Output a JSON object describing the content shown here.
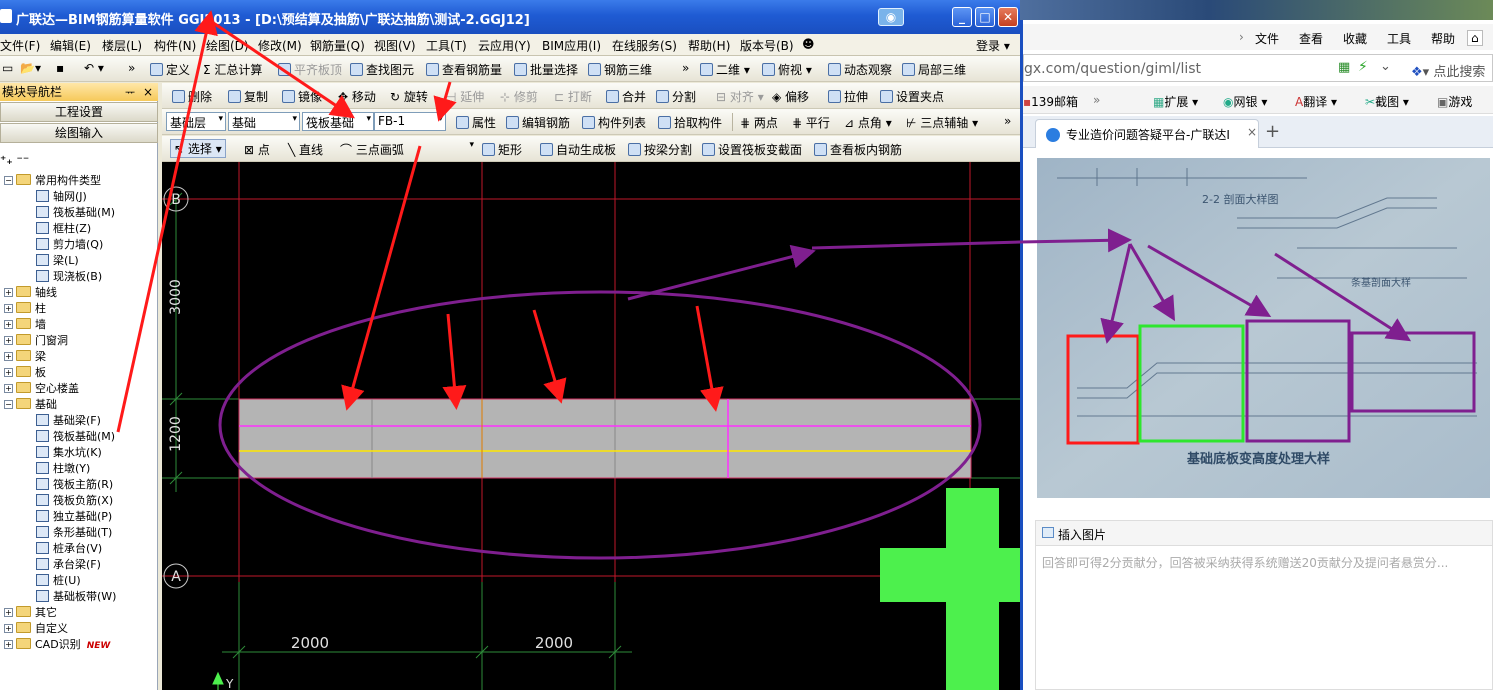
{
  "app": {
    "title": "广联达—BIM钢筋算量软件 GGJ2013 - [D:\\预结算及抽筋\\广联达抽筋\\测试-2.GGJ12]",
    "menus": [
      "文件(F)",
      "编辑(E)",
      "楼层(L)",
      "构件(N)",
      "绘图(D)",
      "修改(M)",
      "钢筋量(Q)",
      "视图(V)",
      "工具(T)",
      "云应用(Y)",
      "BIM应用(I)",
      "在线服务(S)",
      "帮助(H)",
      "版本号(B)"
    ],
    "login": "登录",
    "toolbar1": [
      "定义",
      "汇总计算",
      "平齐板顶",
      "查找图元",
      "查看钢筋量",
      "批量选择",
      "钢筋三维",
      "二维",
      "俯视",
      "动态观察",
      "局部三维"
    ],
    "toolbar2": [
      "删除",
      "复制",
      "镜像",
      "移动",
      "旋转",
      "延伸",
      "修剪",
      "打断",
      "合并",
      "分割",
      "对齐",
      "偏移",
      "拉伸",
      "设置夹点"
    ],
    "toolbar3": {
      "layer": "基础层",
      "category": "基础",
      "type": "筏板基础",
      "element": "FB-1",
      "buttons": [
        "属性",
        "编辑钢筋",
        "构件列表",
        "拾取构件",
        "两点",
        "平行",
        "点角",
        "三点辅轴"
      ]
    },
    "toolbar4": [
      "选择",
      "点",
      "直线",
      "三点画弧",
      "矩形",
      "自动生成板",
      "按梁分割",
      "设置筏板变截面",
      "查看板内钢筋"
    ]
  },
  "nav": {
    "title": "模块导航栏",
    "pin": "ᅲ",
    "close": "×",
    "btn_project": "工程设置",
    "btn_draw": "绘图输入",
    "tree": [
      {
        "label": "常用构件类型",
        "level": 0,
        "type": "folder",
        "exp": "−"
      },
      {
        "label": "轴网(J)",
        "level": 1,
        "type": "leaf"
      },
      {
        "label": "筏板基础(M)",
        "level": 1,
        "type": "leaf"
      },
      {
        "label": "框柱(Z)",
        "level": 1,
        "type": "leaf"
      },
      {
        "label": "剪力墙(Q)",
        "level": 1,
        "type": "leaf"
      },
      {
        "label": "梁(L)",
        "level": 1,
        "type": "leaf"
      },
      {
        "label": "现浇板(B)",
        "level": 1,
        "type": "leaf"
      },
      {
        "label": "轴线",
        "level": 0,
        "type": "folder",
        "exp": "+"
      },
      {
        "label": "柱",
        "level": 0,
        "type": "folder",
        "exp": "+"
      },
      {
        "label": "墙",
        "level": 0,
        "type": "folder",
        "exp": "+"
      },
      {
        "label": "门窗洞",
        "level": 0,
        "type": "folder",
        "exp": "+"
      },
      {
        "label": "梁",
        "level": 0,
        "type": "folder",
        "exp": "+"
      },
      {
        "label": "板",
        "level": 0,
        "type": "folder",
        "exp": "+"
      },
      {
        "label": "空心楼盖",
        "level": 0,
        "type": "folder",
        "exp": "+"
      },
      {
        "label": "基础",
        "level": 0,
        "type": "folder",
        "exp": "−"
      },
      {
        "label": "基础梁(F)",
        "level": 1,
        "type": "leaf"
      },
      {
        "label": "筏板基础(M)",
        "level": 1,
        "type": "leaf"
      },
      {
        "label": "集水坑(K)",
        "level": 1,
        "type": "leaf"
      },
      {
        "label": "柱墩(Y)",
        "level": 1,
        "type": "leaf"
      },
      {
        "label": "筏板主筋(R)",
        "level": 1,
        "type": "leaf"
      },
      {
        "label": "筏板负筋(X)",
        "level": 1,
        "type": "leaf"
      },
      {
        "label": "独立基础(P)",
        "level": 1,
        "type": "leaf"
      },
      {
        "label": "条形基础(T)",
        "level": 1,
        "type": "leaf"
      },
      {
        "label": "桩承台(V)",
        "level": 1,
        "type": "leaf"
      },
      {
        "label": "承台梁(F)",
        "level": 1,
        "type": "leaf"
      },
      {
        "label": "桩(U)",
        "level": 1,
        "type": "leaf"
      },
      {
        "label": "基础板带(W)",
        "level": 1,
        "type": "leaf"
      },
      {
        "label": "其它",
        "level": 0,
        "type": "folder",
        "exp": "+"
      },
      {
        "label": "自定义",
        "level": 0,
        "type": "folder",
        "exp": "+"
      },
      {
        "label": "CAD识别",
        "level": 0,
        "type": "folder",
        "exp": "+",
        "badge": "NEW"
      }
    ]
  },
  "canvas": {
    "axis_b": "B",
    "axis_a": "A",
    "dim_v1": "3000",
    "dim_v2": "1200",
    "dim_h1": "2000",
    "dim_h2": "2000",
    "ucs_y": "Y"
  },
  "browser": {
    "menus": [
      "文件",
      "查看",
      "收藏",
      "工具",
      "帮助"
    ],
    "url": "gx.com/question/giml/list",
    "search": "点此搜索",
    "bookmarks": [
      "139邮箱",
      "扩展",
      "网银",
      "翻译",
      "截图",
      "游戏"
    ],
    "tab_title": "专业造价问题答疑平台-广联达I",
    "tab_close": "×",
    "new_tab": "+",
    "insert_image": "插入图片",
    "answer_placeholder": "回答即可得2分贡献分，回答被采纳获得系统赠送20贡献分及提问者悬赏分..."
  },
  "photo_text": {
    "title_top": "2-2 剖面大样图",
    "label_strip": "条基剖面大样",
    "caption": "基础底板变高度处理大样"
  },
  "colors": {
    "titlebar": "#1f5bd3",
    "canvas_bg": "#000000",
    "grid_red": "#c0172a",
    "grid_green": "#2e8b3a",
    "slab_gray": "#b4b4b4",
    "annot_red": "#ff1a1a",
    "annot_purple": "#7f1f8f",
    "magenta": "#ff30ff",
    "cross_green": "#4df04d"
  }
}
